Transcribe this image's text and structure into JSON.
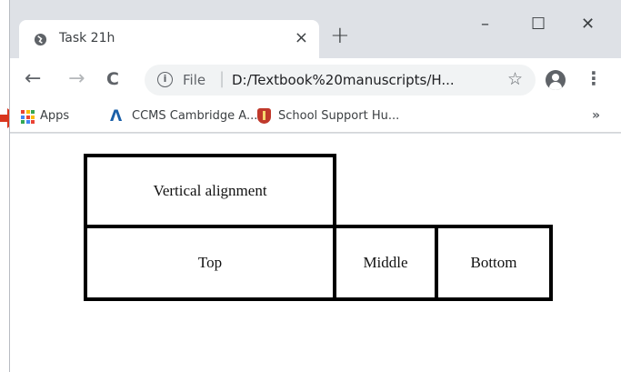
{
  "browser": {
    "tab_title": "Task 21h",
    "tab_close": "×",
    "new_tab": "+",
    "window_minimize": "–",
    "window_maximize": "☐",
    "window_close": "✕",
    "back": "←",
    "forward": "→",
    "reload": "C",
    "url_scheme": "File",
    "url_separator": "|",
    "url": "D:/Textbook%20manuscripts/H...",
    "bookmark_star": "☆",
    "menu": "⋮"
  },
  "bookmarks": {
    "items": [
      {
        "label": "Apps",
        "icon": "apps-grid-icon"
      },
      {
        "label": "CCMS Cambridge A...",
        "icon": "cambridge-icon"
      },
      {
        "label": "School Support Hu...",
        "icon": "shield-icon"
      }
    ],
    "more": "»"
  },
  "annotation": {
    "arrow_color": "#d9361e"
  },
  "table": {
    "header": "Vertical alignment",
    "cells": [
      "Top",
      "Middle",
      "Bottom"
    ]
  }
}
